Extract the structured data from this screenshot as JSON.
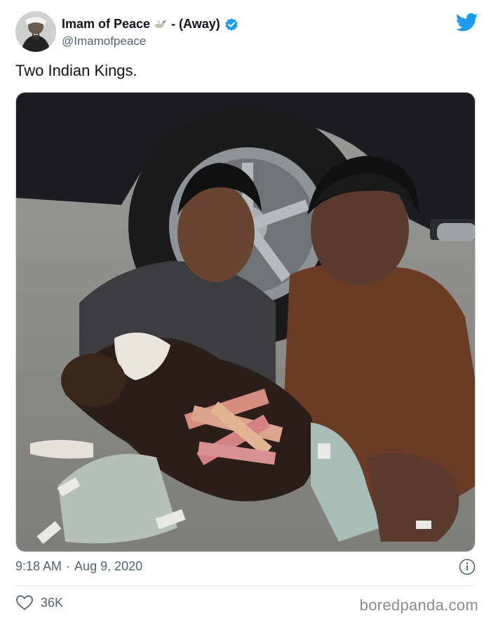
{
  "tweet": {
    "display_name": "Imam of Peace",
    "status_suffix": "- (Away)",
    "handle": "@Imamofpeace",
    "text": "Two Indian Kings.",
    "time": "9:18 AM",
    "separator": "·",
    "date": "Aug 9, 2020",
    "likes": "36K"
  },
  "icons": {
    "avatar": "avatar",
    "name_emoji": "dove-icon",
    "verified": "verified-badge-icon",
    "brand": "twitter-bird-icon",
    "info": "info-icon",
    "like": "heart-icon"
  },
  "watermark": "boredpanda.com",
  "colors": {
    "twitter_blue": "#1d9bf0",
    "secondary_text": "#536471",
    "primary_text": "#0f1419"
  }
}
